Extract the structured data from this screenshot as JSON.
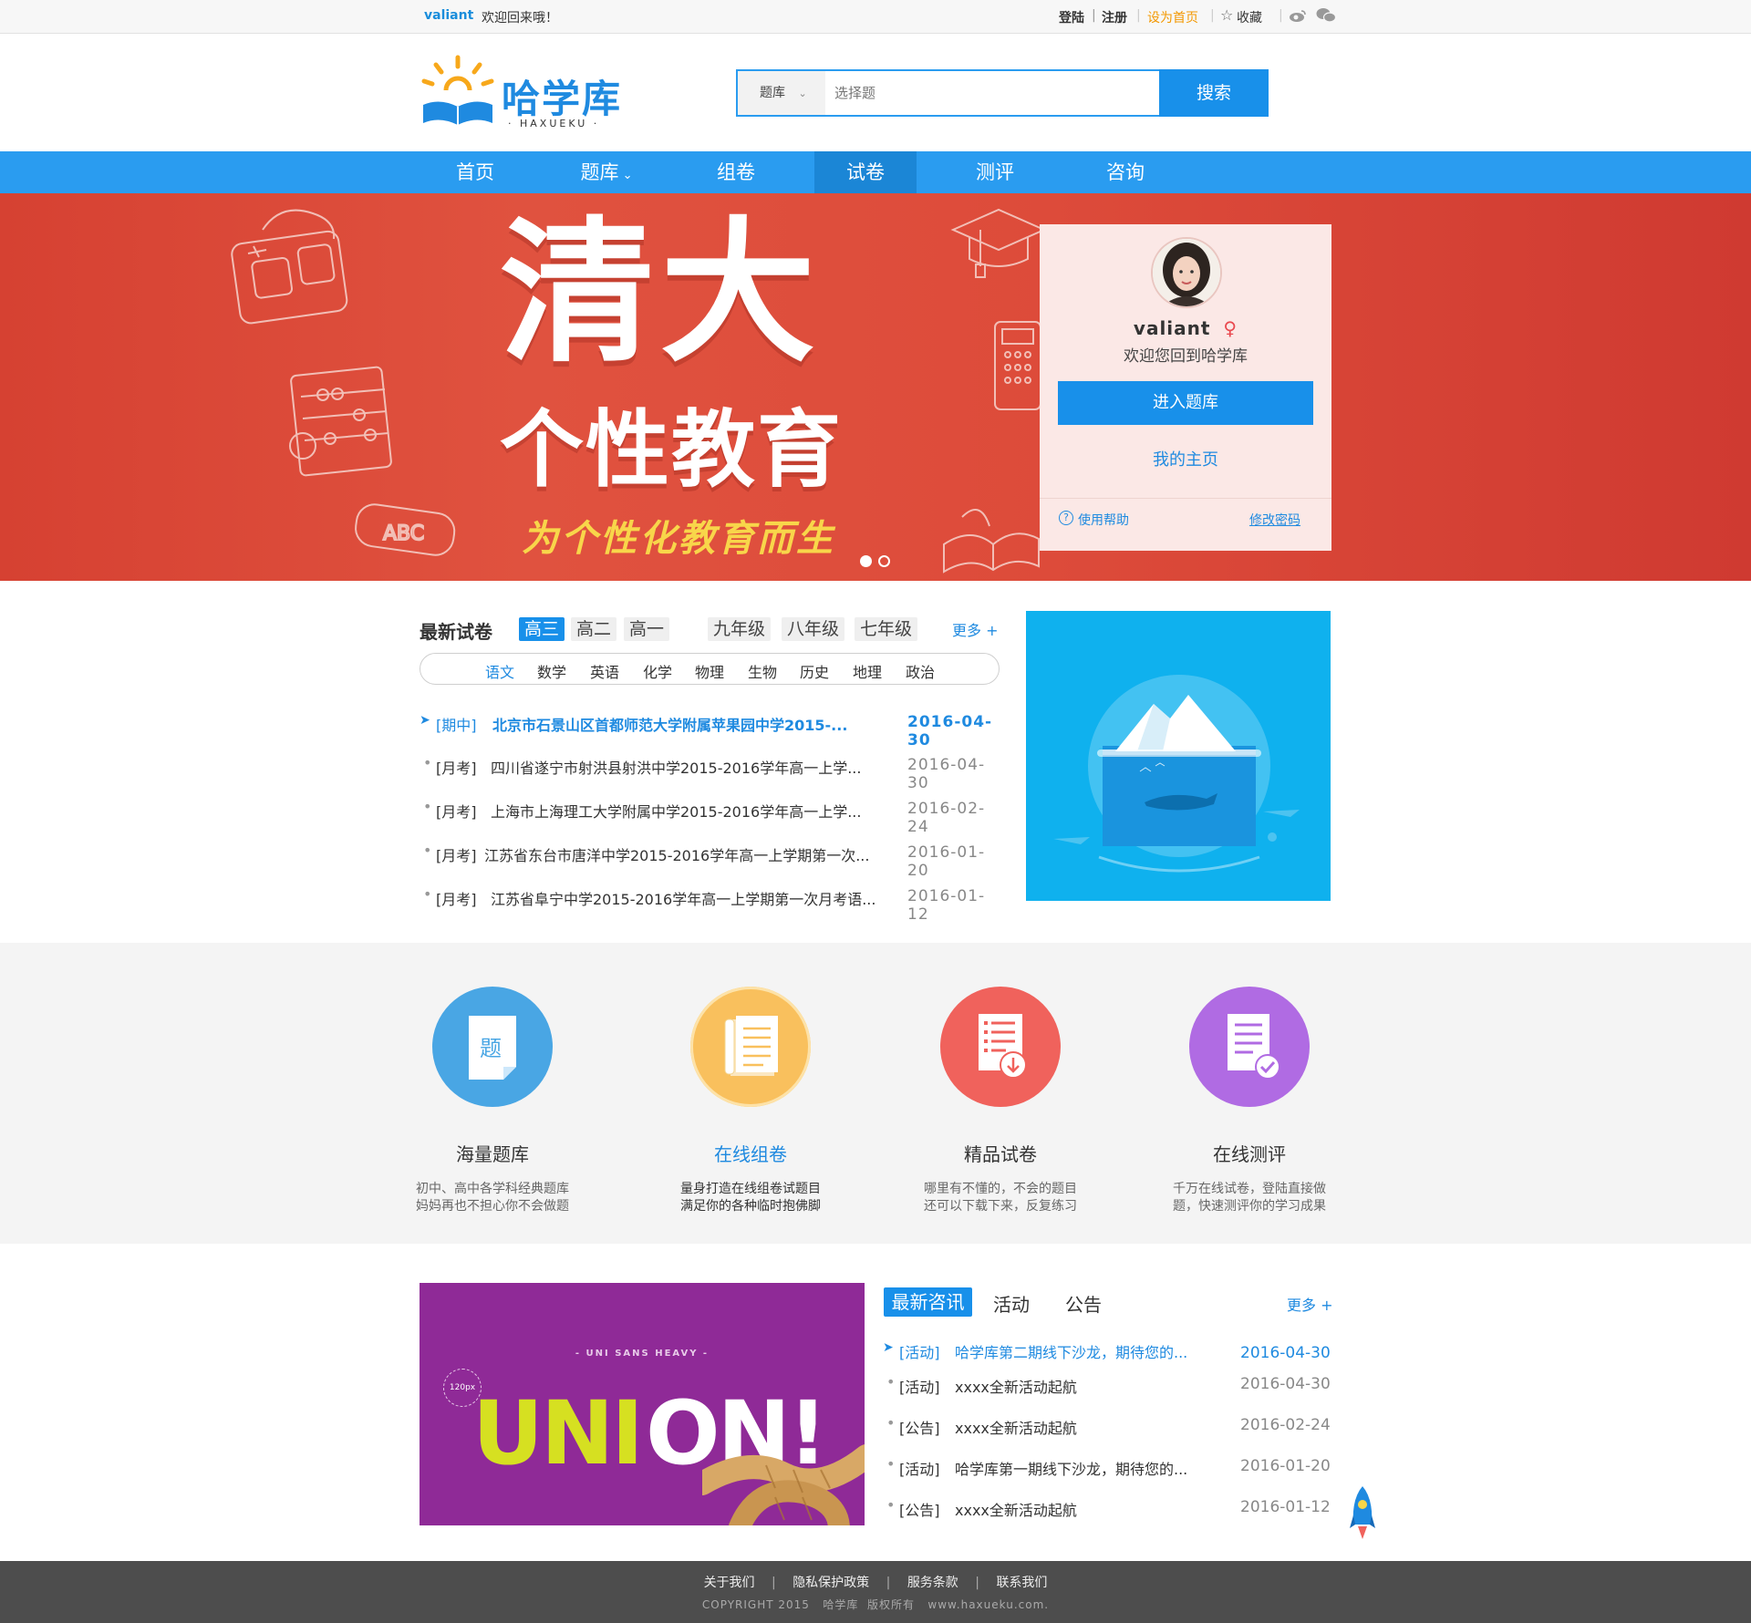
{
  "topbar": {
    "username": "valiant",
    "welcome": "欢迎回来哦！",
    "login": "登陆",
    "register": "注册",
    "set_home": "设为首页",
    "favorite": "收藏"
  },
  "brand": {
    "name": "哈学库",
    "pinyin": "· HAXUEKU ·"
  },
  "search": {
    "category": "题库",
    "placeholder": "选择题",
    "button": "搜索"
  },
  "nav": {
    "items": [
      {
        "label": "首页"
      },
      {
        "label": "题库"
      },
      {
        "label": "组卷"
      },
      {
        "label": "试卷"
      },
      {
        "label": "测评"
      },
      {
        "label": "咨询"
      }
    ]
  },
  "banner": {
    "headline1": "清大",
    "headline2": "个性教育",
    "tagline": "为个性化教育而生",
    "slide_count": 2,
    "active_slide": 1
  },
  "user_card": {
    "name": "valiant",
    "gender_symbol": "♀",
    "greeting": "欢迎您回到哈学库",
    "enter_button": "进入题库",
    "homepage_link": "我的主页",
    "help_icon": "?",
    "help_link": "使用帮助",
    "change_password": "修改密码"
  },
  "papers": {
    "title": "最新试卷",
    "more": "更多 +",
    "grades": [
      "高三",
      "高二",
      "高一",
      "九年级",
      "八年级",
      "七年级"
    ],
    "subjects": [
      "语文",
      "数学",
      "英语",
      "化学",
      "物理",
      "生物",
      "历史",
      "地理",
      "政治"
    ],
    "rows": [
      {
        "tag": "[期中]",
        "title": "北京市石景山区首都师范大学附属苹果园中学2015-...",
        "date": "2016-04-30"
      },
      {
        "tag": "[月考]",
        "title": "四川省遂宁市射洪县射洪中学2015-2016学年高一上学...",
        "date": "2016-04-30"
      },
      {
        "tag": "[月考]",
        "title": "上海市上海理工大学附属中学2015-2016学年高一上学...",
        "date": "2016-02-24"
      },
      {
        "tag": "[月考]",
        "title": "江苏省东台市唐洋中学2015-2016学年高一上学期第一次...",
        "date": "2016-01-20"
      },
      {
        "tag": "[月考]",
        "title": "江苏省阜宁中学2015-2016学年高一上学期第一次月考语...",
        "date": "2016-01-12"
      }
    ]
  },
  "features": [
    {
      "title": "海量题库",
      "desc1": "初中、高中各学科经典题库",
      "desc2": "妈妈再也不担心你不会做题",
      "icon": "question-bank-icon",
      "color": "#49a6e4",
      "icon_text": "题"
    },
    {
      "title": "在线组卷",
      "desc1": "量身打造在线组卷试题目",
      "desc2": "满足你的各种临时抱佛脚",
      "icon": "compose-paper-icon",
      "color": "#f9c05d"
    },
    {
      "title": "精品试卷",
      "desc1": "哪里有不懂的，不会的题目",
      "desc2": "还可以下载下来，反复练习",
      "icon": "download-paper-icon",
      "color": "#f0625c"
    },
    {
      "title": "在线测评",
      "desc1": "千万在线试卷，登陆直接做",
      "desc2": "题，快速测评你的学习成果",
      "icon": "evaluation-icon",
      "color": "#b06be3"
    }
  ],
  "news": {
    "tabs": [
      "最新咨讯",
      "活动",
      "公告"
    ],
    "more": "更多 +",
    "rows": [
      {
        "tag": "[活动]",
        "title": "哈学库第二期线下沙龙，期待您的...",
        "date": "2016-04-30"
      },
      {
        "tag": "[活动]",
        "title": "xxxx全新活动起航",
        "date": "2016-04-30"
      },
      {
        "tag": "[公告]",
        "title": "xxxx全新活动起航",
        "date": "2016-02-24"
      },
      {
        "tag": "[活动]",
        "title": "哈学库第一期线下沙龙，期待您的...",
        "date": "2016-01-20"
      },
      {
        "tag": "[公告]",
        "title": "xxxx全新活动起航",
        "date": "2016-01-12"
      }
    ]
  },
  "promo": {
    "small_caption": "- UNI SANS HEAVY -",
    "size_badge": "120px",
    "text_uni": "UNI",
    "text_on": "ON!"
  },
  "footer": {
    "links": [
      "关于我们",
      "隐私保护政策",
      "服务条款",
      "联系我们"
    ],
    "copyright": "COPYRIGHT 2015   哈学库  版权所有   www.haxueku.com."
  },
  "colors": {
    "primary": "#2a9cf0",
    "orange": "#f39800",
    "banner_red": "#dd4b3a",
    "footer": "#4d4d4d"
  }
}
